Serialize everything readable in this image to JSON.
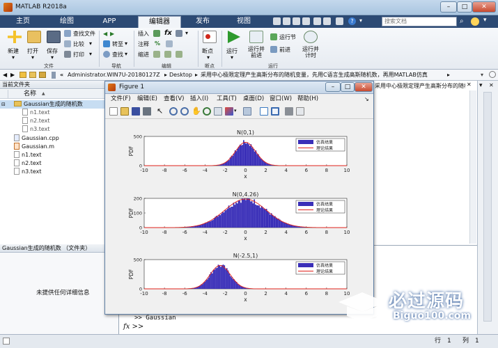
{
  "window": {
    "title": "MATLAB R2018a"
  },
  "tabs": [
    {
      "label": "主页"
    },
    {
      "label": "绘图"
    },
    {
      "label": "APP"
    },
    {
      "label": "编辑器"
    },
    {
      "label": "发布"
    },
    {
      "label": "视图"
    }
  ],
  "search": {
    "placeholder": "搜索文档"
  },
  "toolstrip": {
    "file": {
      "new": "新建",
      "open": "打开",
      "save": "保存",
      "find_files": "查找文件",
      "compare": "比较",
      "print": "打印",
      "section": "文件"
    },
    "nav": {
      "goto": "转至",
      "find": "查找",
      "section": "导航"
    },
    "edit": {
      "insert": "插入",
      "fx": "fx",
      "comment": "注释",
      "percent": "%",
      "indent": "缩进",
      "section": "编辑"
    },
    "breakpoint": {
      "label": "断点",
      "section": "断点"
    },
    "run": {
      "run": "运行",
      "run_advance": "运行并\n前进",
      "run_section": "运行节",
      "advance": "前进",
      "run_time": "运行并\n计时",
      "section": "运行"
    }
  },
  "address": {
    "path_prefix": "«",
    "parts": [
      "Administrator.WIN7U-20180127Z",
      "Desktop",
      "采用中心极限定理产生高斯分布的随机变量，先用C语言生成高斯随机数，再用MATLAB仿真"
    ],
    "tail": "采用中心极限定理产生高斯分布的随机变量，先用C语言生成高"
  },
  "current_folder": {
    "title": "当前文件夹",
    "col_name": "名称",
    "col_sort": "▲",
    "items": [
      {
        "name": "Gaussian生成的随机数",
        "type": "folder",
        "level": 0
      },
      {
        "name": "n1.text",
        "type": "file",
        "level": 1
      },
      {
        "name": "n2.text",
        "type": "file",
        "level": 1
      },
      {
        "name": "n3.text",
        "type": "file",
        "level": 1
      },
      {
        "name": "Gaussian.cpp",
        "type": "file",
        "level": 0
      },
      {
        "name": "Gaussian.m",
        "type": "file",
        "level": 0
      },
      {
        "name": "n1.text",
        "type": "file",
        "level": 0
      },
      {
        "name": "n2.text",
        "type": "file",
        "level": 0
      },
      {
        "name": "n3.text",
        "type": "file",
        "level": 0
      }
    ]
  },
  "details": {
    "title": "Gaussian生成的随机数 （文件夹）",
    "empty": "未提供任何详细信息"
  },
  "command": {
    "history_line": ">> Gaussian",
    "prompt": "fx >>"
  },
  "status": {
    "row_label": "行",
    "row_value": "1",
    "col_label": "列",
    "col_value": "1"
  },
  "figure": {
    "title": "Figure 1",
    "menu": [
      "文件(F)",
      "编辑(E)",
      "查看(V)",
      "插入(I)",
      "工具(T)",
      "桌面(D)",
      "窗口(W)",
      "帮助(H)"
    ]
  },
  "watermark": {
    "text_cn": "必过源码",
    "text_en": "Biguo100.com"
  },
  "colors": {
    "tab_bar": "#2c4a74",
    "hist_fill": "#3a2fb8",
    "pdf_line": "#e0201a",
    "accent": "#1a6fc9"
  },
  "chart_data": [
    {
      "type": "bar",
      "title": "N(0,1)",
      "xlabel": "x",
      "ylabel": "PDF",
      "xlim": [
        -10,
        10
      ],
      "ylim": [
        0,
        500
      ],
      "xticks": [
        -10,
        -8,
        -6,
        -4,
        -2,
        0,
        2,
        4,
        6,
        8,
        10
      ],
      "yticks": [
        0,
        500
      ],
      "legend": [
        "仿真结果",
        "理论结果"
      ],
      "legend_position": "top-right",
      "mean": 0,
      "variance": 1,
      "peak": 400
    },
    {
      "type": "bar",
      "title": "N(0,4.26)",
      "xlabel": "x",
      "ylabel": "PDF",
      "xlim": [
        -10,
        10
      ],
      "ylim": [
        0,
        200
      ],
      "xticks": [
        -10,
        -8,
        -6,
        -4,
        -2,
        0,
        2,
        4,
        6,
        8,
        10
      ],
      "yticks": [
        0,
        100,
        200
      ],
      "legend": [
        "仿真结果",
        "理论结果"
      ],
      "legend_position": "top-right",
      "mean": 0,
      "variance": 4.26,
      "peak": 195
    },
    {
      "type": "bar",
      "title": "N(-2.5,1)",
      "xlabel": "x",
      "ylabel": "PDF",
      "xlim": [
        -10,
        10
      ],
      "ylim": [
        0,
        500
      ],
      "xticks": [
        -10,
        -8,
        -6,
        -4,
        -2,
        0,
        2,
        4,
        6,
        8,
        10
      ],
      "yticks": [
        0,
        500
      ],
      "legend": [
        "仿真结果",
        "理论结果"
      ],
      "legend_position": "top-right",
      "mean": -2.5,
      "variance": 1,
      "peak": 400
    }
  ]
}
